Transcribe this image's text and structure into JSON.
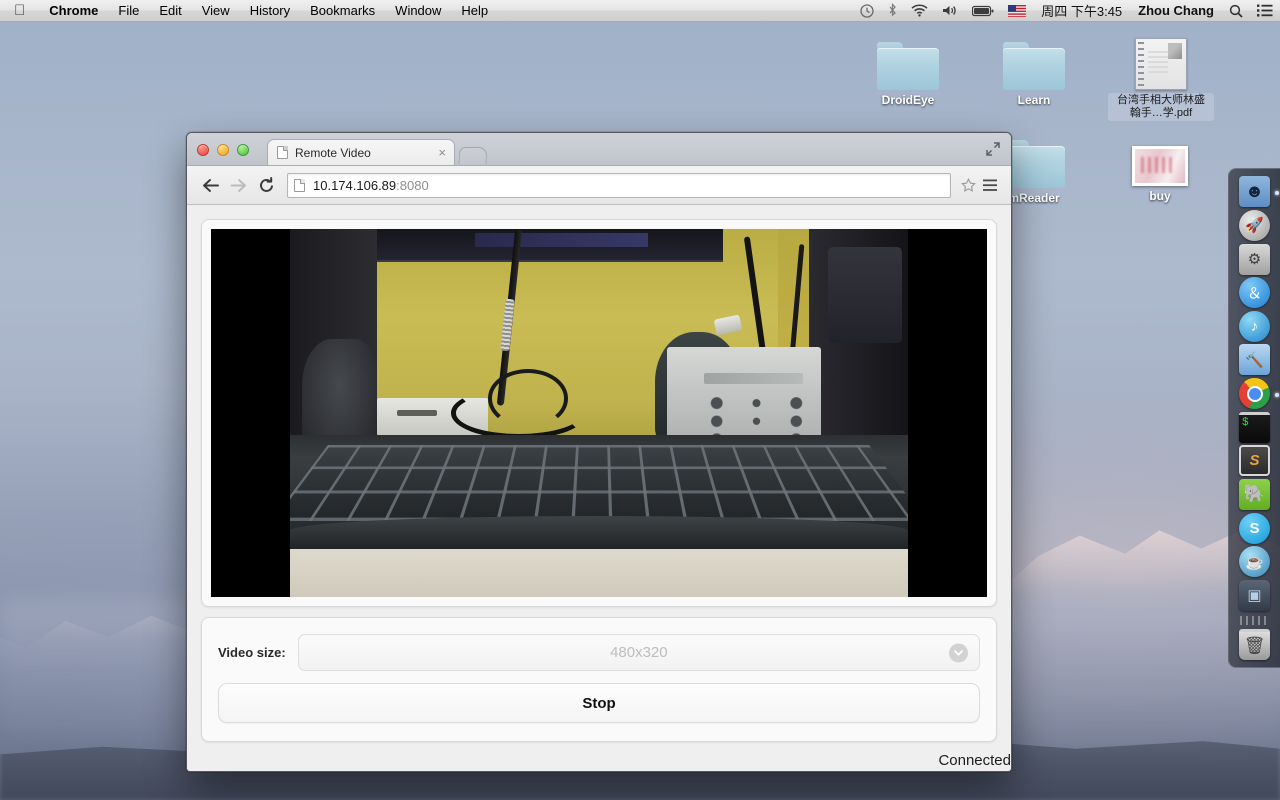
{
  "menubar": {
    "apple_icon": "apple-logo",
    "items": [
      {
        "label": "Chrome",
        "bold": true
      },
      {
        "label": "File",
        "bold": false
      },
      {
        "label": "Edit",
        "bold": false
      },
      {
        "label": "View",
        "bold": false
      },
      {
        "label": "History",
        "bold": false
      },
      {
        "label": "Bookmarks",
        "bold": false
      },
      {
        "label": "Window",
        "bold": false
      },
      {
        "label": "Help",
        "bold": false
      }
    ],
    "status_icons": [
      {
        "name": "time-machine-icon",
        "glyph": "↺"
      },
      {
        "name": "bluetooth-icon",
        "glyph": "฿"
      },
      {
        "name": "wifi-icon",
        "glyph": "◠"
      },
      {
        "name": "volume-icon",
        "glyph": "🔊"
      },
      {
        "name": "battery-icon",
        "glyph": "▬"
      },
      {
        "name": "input-source-flag-icon",
        "glyph": "⚑"
      }
    ],
    "datetime": "周四 下午3:45",
    "user": "Zhou Chang",
    "search_icon": "search-icon",
    "notification_icon": "notification-center-icon"
  },
  "desktop": {
    "icons": [
      {
        "name": "droideye-folder",
        "label": "DroidEye",
        "type": "folder",
        "selected": false
      },
      {
        "name": "learn-folder",
        "label": "Learn",
        "type": "folder",
        "selected": false
      },
      {
        "name": "palmistry-pdf",
        "label": "台湾手相大师林盛翰手…学.pdf",
        "type": "pdf",
        "selected": true
      },
      {
        "name": "mreader-folder",
        "label": "mReader",
        "type": "folder",
        "selected": false
      },
      {
        "name": "buy-image",
        "label": "buy",
        "type": "image",
        "selected": false
      }
    ]
  },
  "dock": {
    "items": [
      {
        "name": "finder-icon",
        "label": "Finder",
        "running": true
      },
      {
        "name": "launchpad-icon",
        "label": "Launchpad",
        "running": false
      },
      {
        "name": "system-preferences-icon",
        "label": "System Preferences",
        "running": false
      },
      {
        "name": "app-store-icon",
        "label": "App Store",
        "running": false
      },
      {
        "name": "itunes-icon",
        "label": "iTunes",
        "running": false
      },
      {
        "name": "xcode-icon",
        "label": "Xcode",
        "running": false
      },
      {
        "name": "chrome-icon",
        "label": "Google Chrome",
        "running": true
      },
      {
        "name": "terminal-icon",
        "label": "Terminal",
        "running": false
      },
      {
        "name": "sublime-text-icon",
        "label": "Sublime Text",
        "running": false
      },
      {
        "name": "evernote-icon",
        "label": "Evernote",
        "running": false
      },
      {
        "name": "skype-icon",
        "label": "Skype",
        "running": false
      },
      {
        "name": "cyberduck-icon",
        "label": "Cyberduck",
        "running": false
      },
      {
        "name": "virtualbox-icon",
        "label": "VirtualBox",
        "running": false
      }
    ],
    "trash_label": "Trash"
  },
  "browser": {
    "traffic_lights": [
      "close",
      "minimize",
      "zoom"
    ],
    "tab": {
      "title": "Remote Video",
      "close_label": "×"
    },
    "new_tab_label": "+",
    "expand_icon": "fullscreen-arrows-icon",
    "toolbar": {
      "back_label": "←",
      "forward_label": "→",
      "reload_label": "⟳",
      "star_label": "☆",
      "menu_label": "≡"
    },
    "address": {
      "host": "10.174.106.89",
      "port": ":8080",
      "full": "10.174.106.89:8080"
    }
  },
  "page": {
    "video_size_label": "Video size:",
    "video_size_value": "480x320",
    "chevron_glyph": "▾",
    "stop_button_label": "Stop",
    "status_text": "Connected"
  }
}
